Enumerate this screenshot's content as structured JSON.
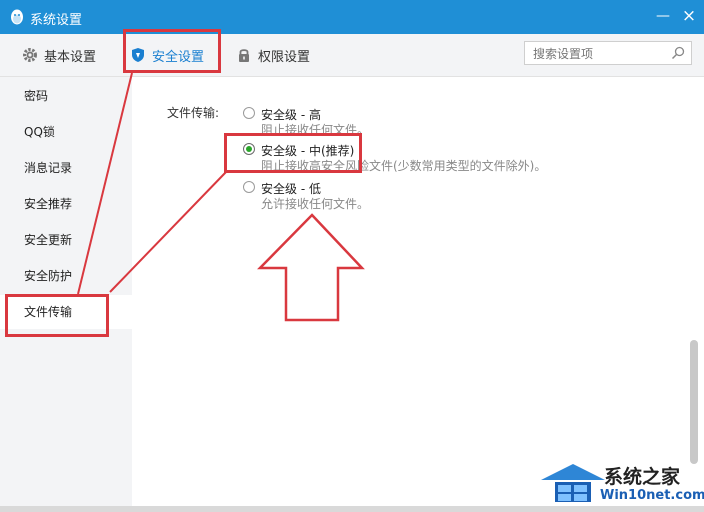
{
  "window": {
    "title": "系统设置",
    "minimize": "—",
    "close": "×"
  },
  "tabs": [
    {
      "label": "基本设置",
      "icon": "gear-icon"
    },
    {
      "label": "安全设置",
      "icon": "shield-icon"
    },
    {
      "label": "权限设置",
      "icon": "lock-icon"
    }
  ],
  "search": {
    "placeholder": "搜索设置项"
  },
  "sidebar": {
    "items": [
      {
        "label": "密码"
      },
      {
        "label": "QQ锁"
      },
      {
        "label": "消息记录"
      },
      {
        "label": "安全推荐"
      },
      {
        "label": "安全更新"
      },
      {
        "label": "安全防护"
      },
      {
        "label": "文件传输"
      }
    ]
  },
  "file_transfer": {
    "label": "文件传输:",
    "options": [
      {
        "title": "安全级 - 高",
        "desc": "阻止接收任何文件。",
        "checked": false
      },
      {
        "title": "安全级 - 中(推荐)",
        "desc": "阻止接收高安全风险文件(少数常用类型的文件除外)。",
        "checked": true
      },
      {
        "title": "安全级 - 低",
        "desc": "允许接收任何文件。",
        "checked": false
      }
    ]
  },
  "watermark": {
    "line1": "系统之家",
    "line2": "Win10net.com"
  },
  "colors": {
    "titlebar": "#1f8fd6",
    "accent": "#1a7fd0",
    "annotation": "#d9383f",
    "radio_checked": "#2aa52a"
  }
}
